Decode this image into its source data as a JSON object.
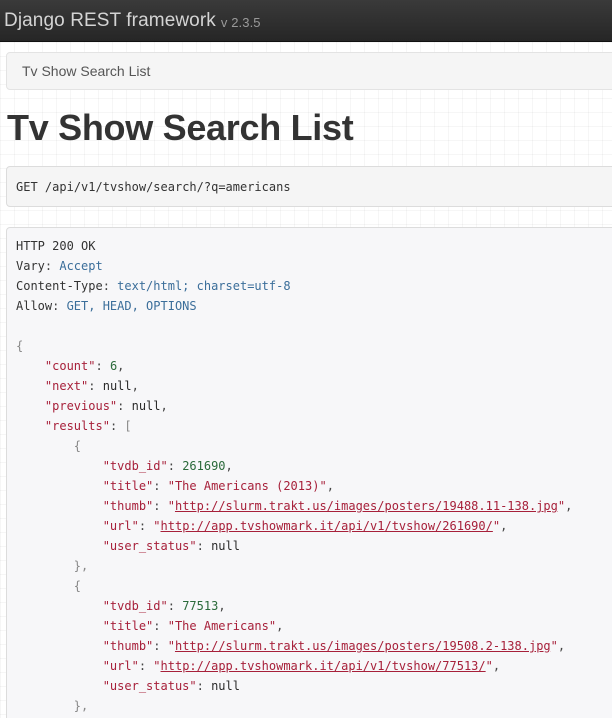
{
  "navbar": {
    "brand": "Django REST framework",
    "version": "v 2.3.5"
  },
  "breadcrumb": {
    "current": "Tv Show Search List"
  },
  "page": {
    "title": "Tv Show Search List"
  },
  "request": {
    "method": "GET",
    "path": "/api/v1/tvshow/search/?q=americans"
  },
  "response": {
    "status": "HTTP 200 OK",
    "headers": [
      {
        "name": "Vary",
        "value": "Accept"
      },
      {
        "name": "Content-Type",
        "value": "text/html; charset=utf-8"
      },
      {
        "name": "Allow",
        "value": "GET, HEAD, OPTIONS"
      }
    ],
    "count": "6",
    "next": "null",
    "previous": "null",
    "results": [
      {
        "tvdb_id": "261690",
        "title": "\"The Americans (2013)\"",
        "thumb": "http://slurm.trakt.us/images/posters/19488.11-138.jpg",
        "url": "http://app.tvshowmark.it/api/v1/tvshow/261690/",
        "user_status": "null"
      },
      {
        "tvdb_id": "77513",
        "title": "\"The Americans\"",
        "thumb": "http://slurm.trakt.us/images/posters/19508.2-138.jpg",
        "url": "http://app.tvshowmark.it/api/v1/tvshow/77513/",
        "user_status": "null"
      }
    ]
  }
}
